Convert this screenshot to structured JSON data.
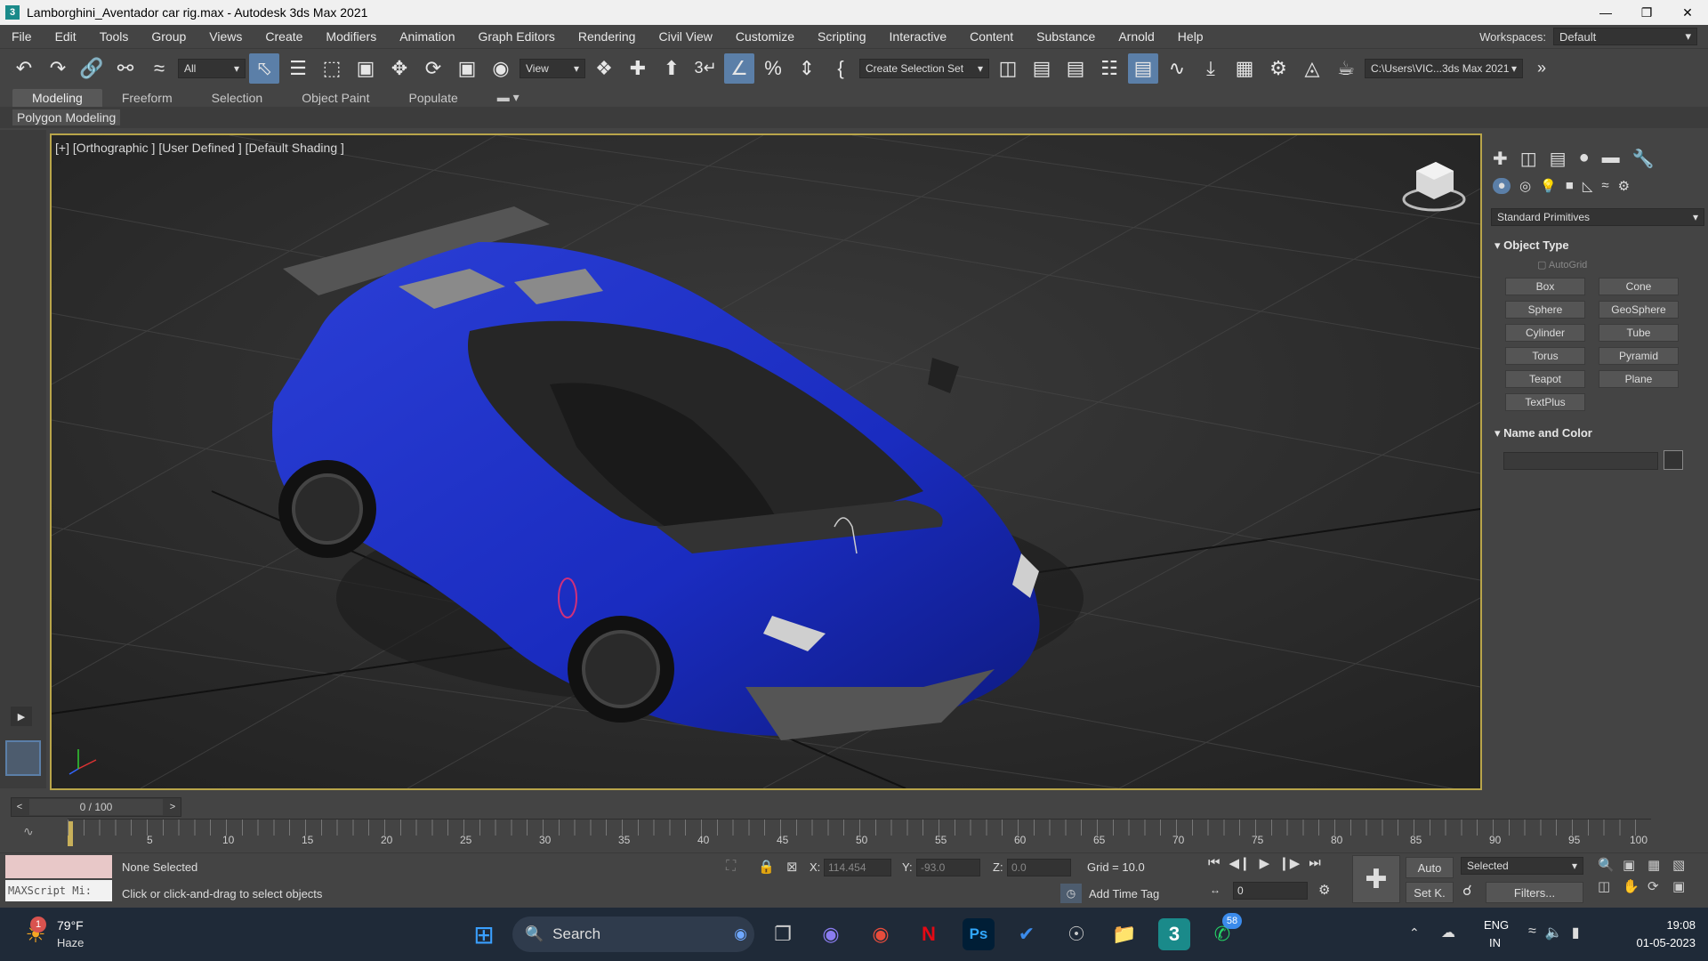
{
  "window": {
    "title": "Lamborghini_Aventador car rig.max - Autodesk 3ds Max 2021"
  },
  "menu": [
    "File",
    "Edit",
    "Tools",
    "Group",
    "Views",
    "Create",
    "Modifiers",
    "Animation",
    "Graph Editors",
    "Rendering",
    "Civil View",
    "Customize",
    "Scripting",
    "Interactive",
    "Content",
    "Substance",
    "Arnold",
    "Help"
  ],
  "workspace": {
    "label": "Workspaces:",
    "value": "Default"
  },
  "toolbar": {
    "filter_value": "All",
    "ref_coord_value": "View",
    "selection_set_value": "Create Selection Set",
    "project_path": "C:\\Users\\VIC...3ds Max 2021"
  },
  "ribbon": {
    "tabs": [
      "Modeling",
      "Freeform",
      "Selection",
      "Object Paint",
      "Populate"
    ],
    "sub_label": "Polygon Modeling"
  },
  "viewport": {
    "label": "[+] [Orthographic ] [User Defined ] [Default Shading ]"
  },
  "command_panel": {
    "category": "Standard Primitives",
    "object_type_title": "Object Type",
    "autogrid": "AutoGrid",
    "buttons": [
      "Box",
      "Cone",
      "Sphere",
      "GeoSphere",
      "Cylinder",
      "Tube",
      "Torus",
      "Pyramid",
      "Teapot",
      "Plane",
      "TextPlus"
    ],
    "name_color_title": "Name and Color"
  },
  "timeline": {
    "frame": "0 / 100",
    "ticks": [
      "5",
      "10",
      "15",
      "20",
      "25",
      "30",
      "35",
      "40",
      "45",
      "50",
      "55",
      "60",
      "65",
      "70",
      "75",
      "80",
      "85",
      "90",
      "95",
      "100"
    ]
  },
  "status": {
    "maxscript": "MAXScript Mi:",
    "selection": "None Selected",
    "prompt": "Click or click-and-drag to select objects",
    "x_label": "X:",
    "x_value": "114.454",
    "y_label": "Y:",
    "y_value": "-93.0",
    "z_label": "Z:",
    "z_value": "0.0",
    "grid": "Grid = 10.0",
    "add_time_tag": "Add Time Tag",
    "auto": "Auto",
    "setk": "Set K.",
    "selected_value": "Selected",
    "filters": "Filters...",
    "frame_field": "0"
  },
  "taskbar": {
    "weather_temp": "79°F",
    "weather_desc": "Haze",
    "weather_badge": "1",
    "search": "Search",
    "whatsapp_badge": "58",
    "lang1": "ENG",
    "lang2": "IN",
    "time": "19:08",
    "date": "01-05-2023"
  }
}
